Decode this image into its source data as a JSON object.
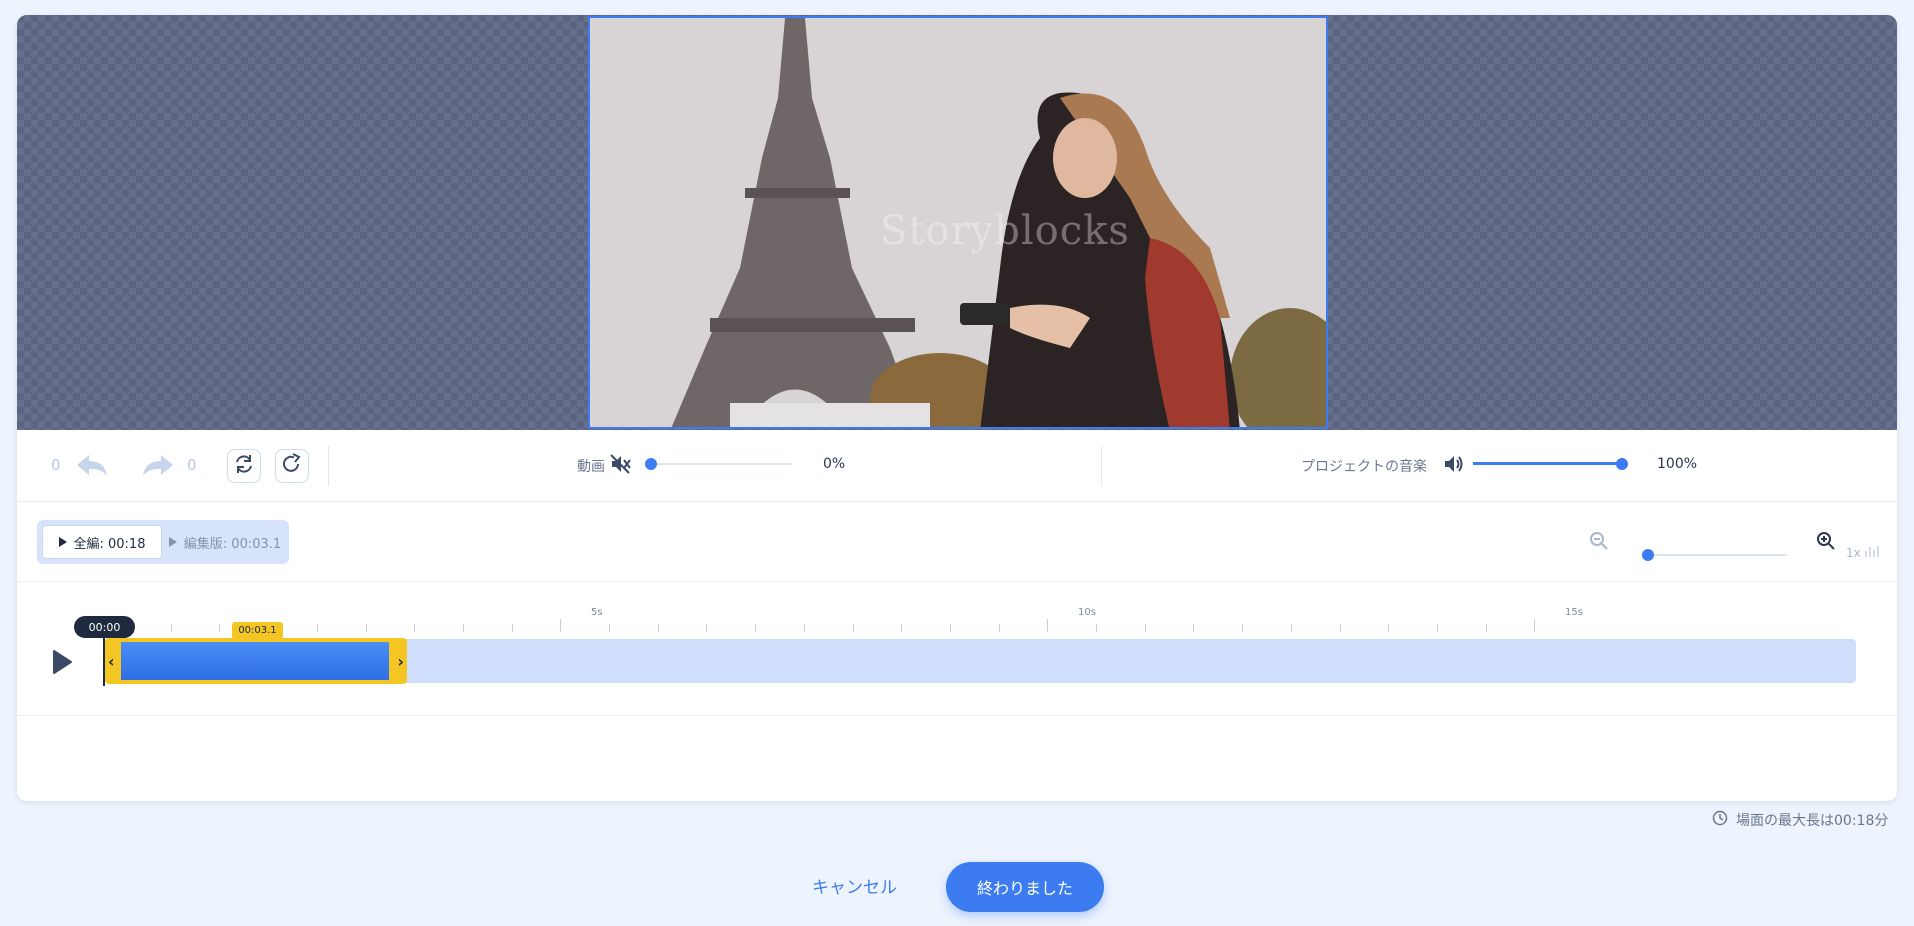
{
  "preview": {
    "watermark": "Storyblocks"
  },
  "history": {
    "undo_count": "0",
    "redo_count": "0"
  },
  "volume": {
    "video_label": "動画",
    "video_value": "0%",
    "video_level": 0,
    "music_label": "プロジェクトの音楽",
    "music_value": "100%",
    "music_level": 1
  },
  "playback_toggle": {
    "full_label": "全編: 00:18",
    "edited_label": "編集版: 00:03.1"
  },
  "zoom": {
    "level_label": "1x",
    "level": 0
  },
  "timeline": {
    "playhead_time": "00:00",
    "clip_duration": "00:03.1",
    "tick_labels": [
      "5s",
      "10s",
      "15s"
    ]
  },
  "footer": {
    "max_length_note": "場面の最大長は00:18分",
    "cancel_label": "キャンセル",
    "done_label": "終わりました"
  },
  "colors": {
    "accent": "#3d7cf0",
    "selection": "#f3c623",
    "dark": "#1f2a3f"
  }
}
